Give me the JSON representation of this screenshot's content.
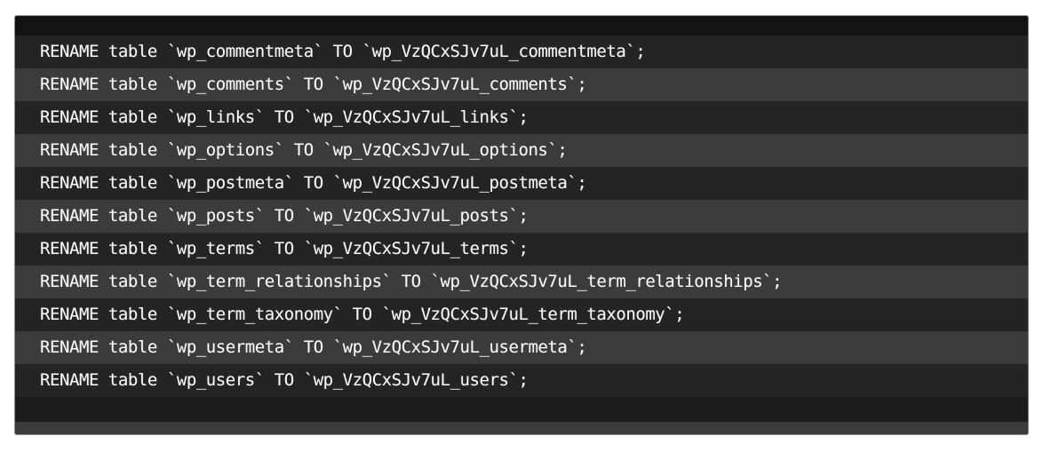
{
  "panel": {
    "kind": "sql-code-block",
    "background_color": "#1b1b1b",
    "row_odd_color": "#232323",
    "row_even_color": "#3b3b3b",
    "text_color": "#fdfdfd",
    "border_color": "#8f8f8f"
  },
  "code": {
    "language": "sql",
    "old_prefix": "wp_",
    "new_prefix": "wp_VzQCxSJv7uL_",
    "lines": [
      "RENAME table `wp_commentmeta` TO `wp_VzQCxSJv7uL_commentmeta`;",
      "RENAME table `wp_comments` TO `wp_VzQCxSJv7uL_comments`;",
      "RENAME table `wp_links` TO `wp_VzQCxSJv7uL_links`;",
      "RENAME table `wp_options` TO `wp_VzQCxSJv7uL_options`;",
      "RENAME table `wp_postmeta` TO `wp_VzQCxSJv7uL_postmeta`;",
      "RENAME table `wp_posts` TO `wp_VzQCxSJv7uL_posts`;",
      "RENAME table `wp_terms` TO `wp_VzQCxSJv7uL_terms`;",
      "RENAME table `wp_term_relationships` TO `wp_VzQCxSJv7uL_term_relationships`;",
      "RENAME table `wp_term_taxonomy` TO `wp_VzQCxSJv7uL_term_taxonomy`;",
      "RENAME table `wp_usermeta` TO `wp_VzQCxSJv7uL_usermeta`;",
      "RENAME table `wp_users` TO `wp_VzQCxSJv7uL_users`;"
    ]
  }
}
